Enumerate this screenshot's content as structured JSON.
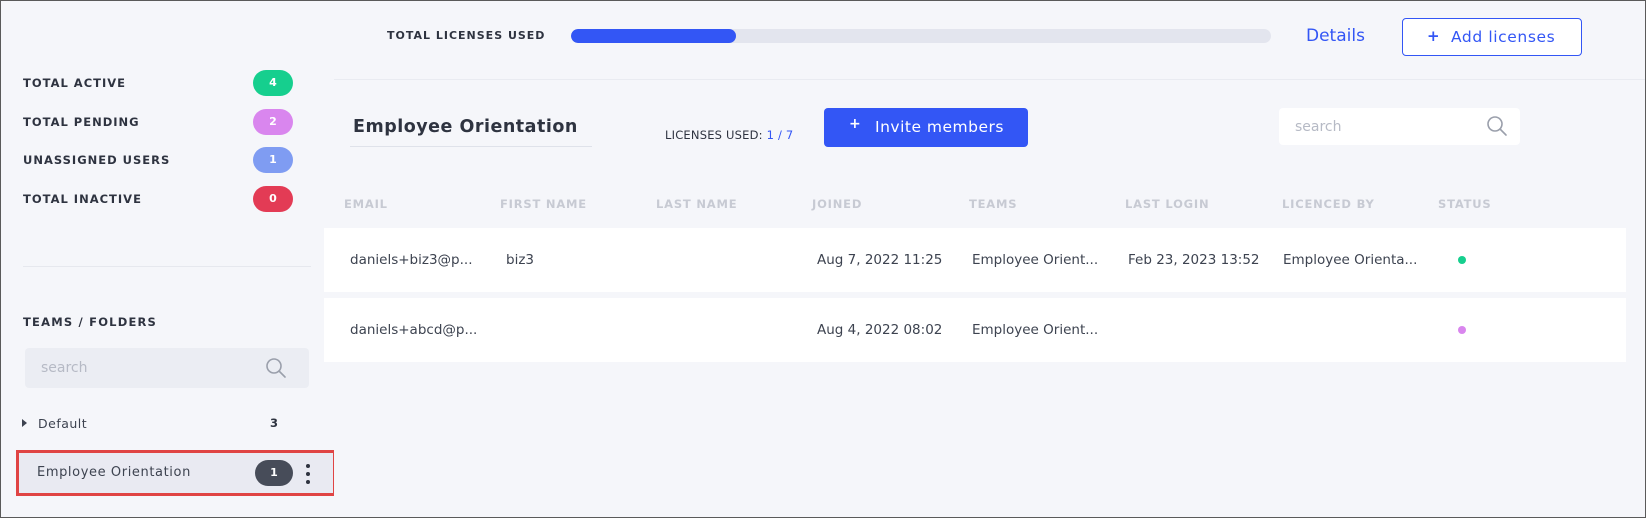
{
  "stats": [
    {
      "label": "TOTAL ACTIVE",
      "count": "4",
      "color": "#16cf8e"
    },
    {
      "label": "TOTAL PENDING",
      "count": "2",
      "color": "#d986ee"
    },
    {
      "label": "UNASSIGNED USERS",
      "count": "1",
      "color": "#7f9cf2"
    },
    {
      "label": "TOTAL INACTIVE",
      "count": "0",
      "color": "#e33b55"
    }
  ],
  "sidebar": {
    "section_title": "TEAMS / FOLDERS",
    "search_placeholder": "search",
    "folders": [
      {
        "label": "Default",
        "count": "3"
      },
      {
        "label": "Employee Orientation",
        "count": "1",
        "selected": true
      }
    ]
  },
  "topbar": {
    "total_licenses_label": "TOTAL LICENSES USED",
    "progress_fraction": 0.235,
    "details_label": "Details",
    "add_licenses_label": "Add licenses"
  },
  "team": {
    "name": "Employee Orientation",
    "licenses_used_label": "LICENSES USED:",
    "licenses_used_value": "1 / 7",
    "invite_label": "Invite members",
    "search_placeholder": "search"
  },
  "table": {
    "columns": [
      "EMAIL",
      "FIRST NAME",
      "LAST NAME",
      "JOINED",
      "TEAMS",
      "LAST LOGIN",
      "LICENCED BY",
      "STATUS"
    ],
    "rows": [
      {
        "email": "daniels+biz3@p...",
        "first_name": "biz3",
        "last_name": "",
        "joined": "Aug 7, 2022 11:25",
        "teams": "Employee Orient...",
        "last_login": "Feb 23, 2023 13:52",
        "licenced_by": "Employee Orienta...",
        "status": "active",
        "status_color": "#16cf8e"
      },
      {
        "email": "daniels+abcd@p...",
        "first_name": "",
        "last_name": "",
        "joined": "Aug 4, 2022 08:02",
        "teams": "Employee Orient...",
        "last_login": "",
        "licenced_by": "",
        "status": "pending",
        "status_color": "#d986ee"
      }
    ]
  },
  "colors": {
    "accent": "#3356f5",
    "highlight_border": "#e04444"
  }
}
